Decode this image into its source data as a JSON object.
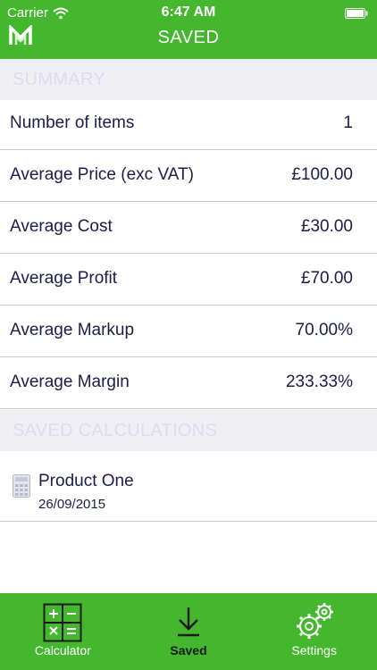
{
  "status_bar": {
    "carrier": "Carrier",
    "time": "6:47 AM"
  },
  "nav": {
    "title": "SAVED"
  },
  "summary": {
    "header": "SUMMARY",
    "rows": [
      {
        "label": "Number of items",
        "value": "1"
      },
      {
        "label": "Average Price (exc VAT)",
        "value": "£100.00"
      },
      {
        "label": "Average Cost",
        "value": "£30.00"
      },
      {
        "label": "Average Profit",
        "value": "£70.00"
      },
      {
        "label": "Average Markup",
        "value": "70.00%"
      },
      {
        "label": "Average Margin",
        "value": "233.33%"
      }
    ]
  },
  "saved": {
    "header": "SAVED CALCULATIONS",
    "items": [
      {
        "name": "Product One",
        "date": "26/09/2015"
      }
    ]
  },
  "tabs": [
    {
      "label": "Calculator",
      "icon": "calculator-icon",
      "active": false
    },
    {
      "label": "Saved",
      "icon": "download-icon",
      "active": true
    },
    {
      "label": "Settings",
      "icon": "gear-icon",
      "active": false
    }
  ],
  "colors": {
    "brand_green": "#44b72f",
    "section_bg": "#efeff4",
    "section_text": "#dcdcf0",
    "text_dark": "#1c1c4a",
    "divider": "#c9c9dc"
  }
}
